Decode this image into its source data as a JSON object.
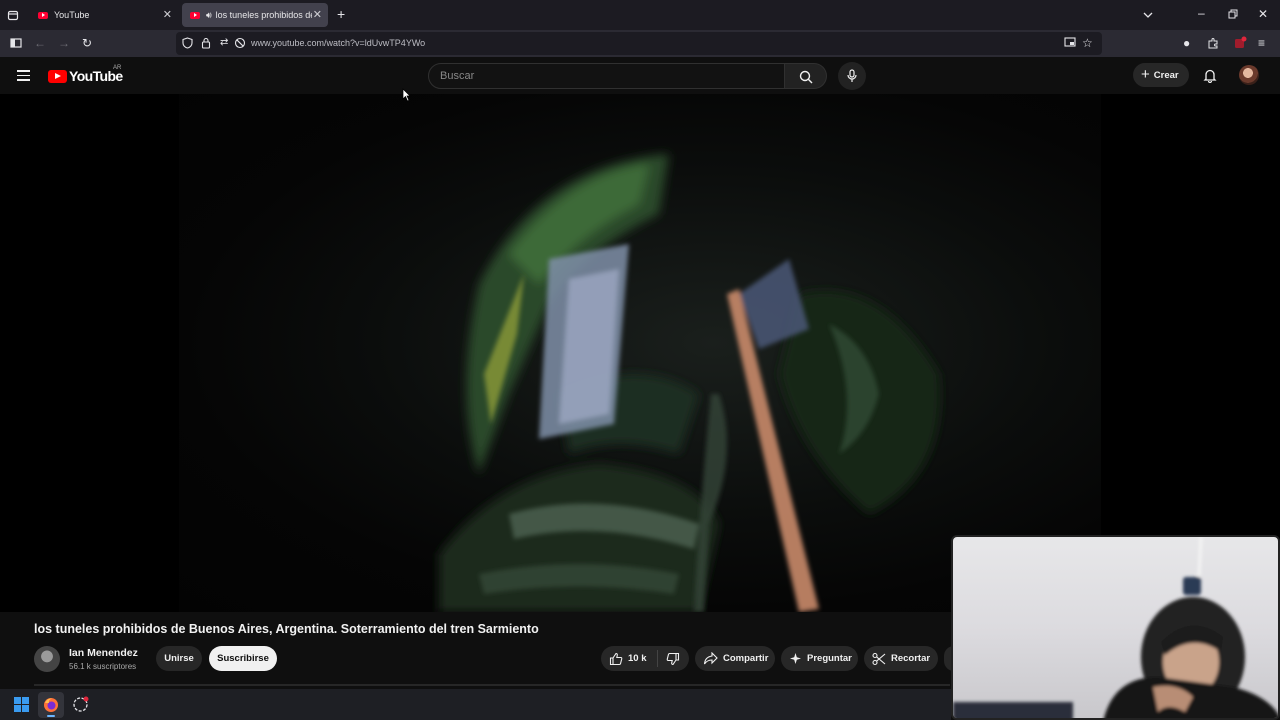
{
  "browser": {
    "tabs": [
      {
        "title": "YouTube"
      },
      {
        "title": "los tuneles prohibidos de B"
      }
    ],
    "url": "www.youtube.com/watch?v=ldUvwTP4YWo"
  },
  "youtube": {
    "logo_text": "YouTube",
    "country_code": "AR",
    "search_placeholder": "Buscar",
    "create_label": "Crear"
  },
  "video": {
    "title": "los tuneles prohibidos de Buenos Aires, Argentina. Soterramiento del tren Sarmiento",
    "channel_name": "Ian Menendez",
    "subscribers": "56.1 k suscriptores",
    "join_label": "Unirse",
    "subscribe_label": "Suscribirse",
    "likes": "10 k",
    "share_label": "Compartir",
    "ask_label": "Preguntar",
    "clip_label": "Recortar"
  },
  "colors": {
    "youtube_red": "#ff0000",
    "background": "#0f0f0f",
    "pill": "#272727"
  }
}
